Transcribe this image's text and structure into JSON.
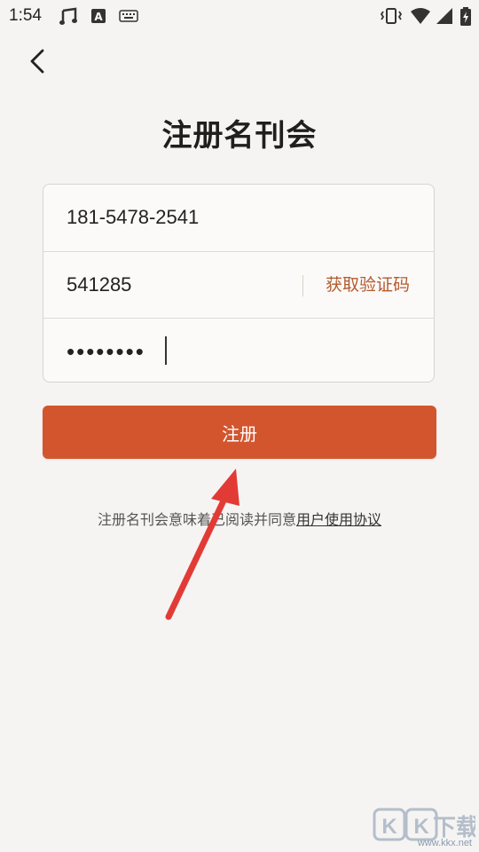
{
  "status_bar": {
    "time": "1:54",
    "icons": [
      "music-note-icon",
      "text-a-icon",
      "keyboard-icon",
      "vibrate-icon",
      "wifi-icon",
      "signal-icon",
      "battery-charging-icon"
    ]
  },
  "header": {
    "title": "注册名刊会"
  },
  "form": {
    "phone_value": "181-5478-2541",
    "code_value": "541285",
    "get_code_label": "获取验证码",
    "password_value": "••••••••"
  },
  "register_button_label": "注册",
  "agreement": {
    "prefix_text": "注册名刊会意味着已阅读并同意",
    "link_text": "用户使用协议"
  },
  "colors": {
    "accent": "#d3552e",
    "link": "#b45a2d",
    "arrow": "#e23b35",
    "background": "#f6f4f2"
  },
  "watermark": {
    "logo_text": "KK下载",
    "url": "www.kkx.net"
  }
}
